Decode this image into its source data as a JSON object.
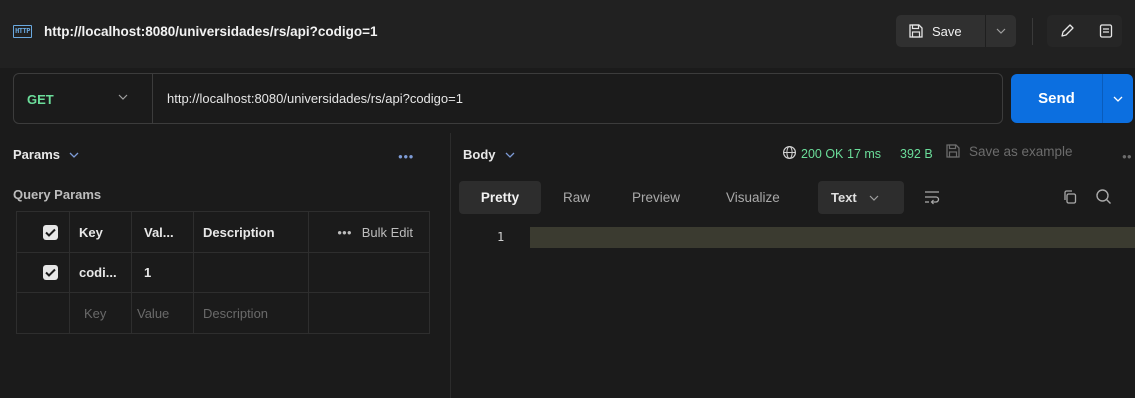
{
  "titlebar": {
    "icon": "http-icon",
    "icon_text": "HTTP",
    "title": "http://localhost:8080/universidades/rs/api?codigo=1",
    "save_label": "Save"
  },
  "request": {
    "method": "GET",
    "url": "http://localhost:8080/universidades/rs/api?codigo=1",
    "send_label": "Send"
  },
  "left": {
    "tab_label": "Params",
    "section_label": "Query Params",
    "table": {
      "headers": [
        "Key",
        "Val...",
        "Description"
      ],
      "bulk_label": "Bulk Edit",
      "rows": [
        {
          "key": "codi...",
          "value": "1",
          "description": ""
        }
      ],
      "placeholders": {
        "key": "Key",
        "value": "Value",
        "description": "Description"
      }
    }
  },
  "right": {
    "tab_label": "Body",
    "status": "200 OK",
    "time": "17 ms",
    "size": "392 B",
    "save_example_label": "Save as example",
    "view_tabs": [
      "Pretty",
      "Raw",
      "Preview",
      "Visualize"
    ],
    "active_view": "Pretty",
    "format": "Text",
    "line_number": "1"
  },
  "colors": {
    "accent": "#0c6fe0",
    "method_get": "#6bdd9a",
    "status_ok": "#6bdd9a",
    "background": "#1b1b1b"
  }
}
